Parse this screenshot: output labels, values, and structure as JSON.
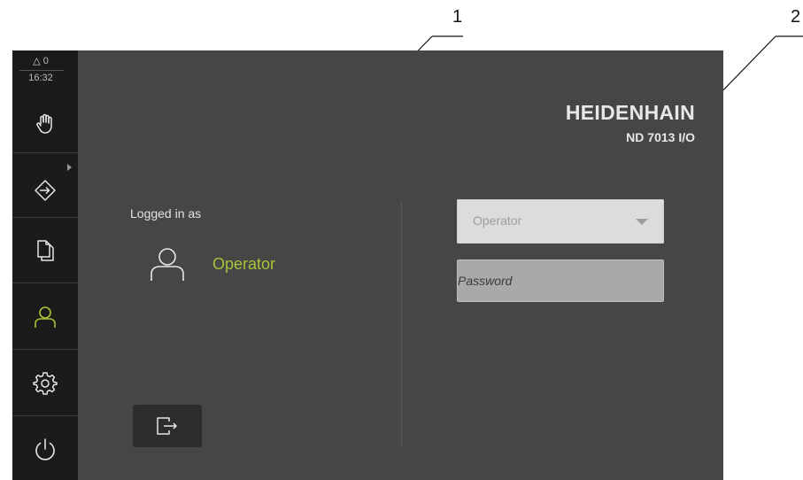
{
  "callouts": [
    "1",
    "2"
  ],
  "status": {
    "message_count": "0",
    "time": "16:32"
  },
  "sidebar": {
    "items": [
      {
        "name": "manual-mode",
        "icon": "hand-icon"
      },
      {
        "name": "mdi-mode",
        "icon": "enter-arrow-icon"
      },
      {
        "name": "file-management",
        "icon": "files-icon"
      },
      {
        "name": "user-login",
        "icon": "user-icon",
        "active": true
      },
      {
        "name": "settings",
        "icon": "gear-icon"
      },
      {
        "name": "power",
        "icon": "power-icon"
      }
    ]
  },
  "brand": {
    "name": "HEIDENHAIN",
    "model": "ND 7013 I/O"
  },
  "session": {
    "logged_in_label": "Logged in as",
    "user": "Operator"
  },
  "login": {
    "selected_user": "Operator",
    "password_placeholder": "Password"
  },
  "colors": {
    "accent": "#a6c437",
    "sidebar_bg": "#1b1b1b",
    "screen_bg": "#464646"
  }
}
